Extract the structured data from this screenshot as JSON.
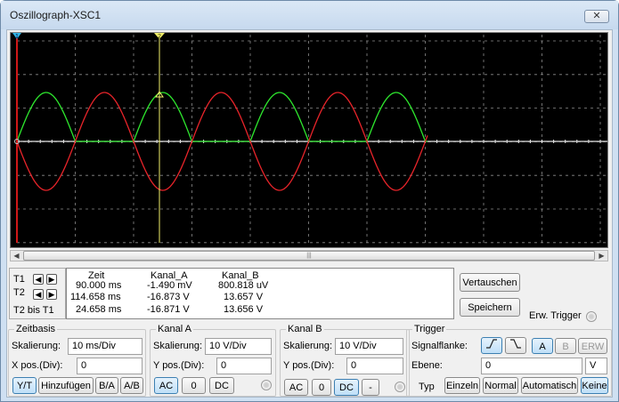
{
  "window": {
    "title": "Oszillograph-XSC1",
    "close_label": "✕"
  },
  "cursors": {
    "t1_label": "T1",
    "t2_label": "T2",
    "diff_label": "T2 bis T1",
    "t1_marker": "1",
    "t2_marker": "2"
  },
  "readout": {
    "headers": [
      "Zeit",
      "Kanal_A",
      "Kanal_B"
    ],
    "rows": [
      [
        "90.000 ms",
        "-1.490 mV",
        "800.818 uV"
      ],
      [
        "114.658 ms",
        "-16.873 V",
        "13.657 V"
      ],
      [
        "24.658 ms",
        "-16.871 V",
        "13.656 V"
      ]
    ]
  },
  "actions": {
    "swap_label": "Vertauschen",
    "save_label": "Speichern",
    "ext_trigger_label": "Erw. Trigger"
  },
  "scrollbar": {
    "left": "◀",
    "right": "▶",
    "grip": "|||"
  },
  "zeitbasis": {
    "title": "Zeitbasis",
    "scale_label": "Skalierung:",
    "scale_value": "10 ms/Div",
    "xpos_label": "X pos.(Div):",
    "xpos_value": "0",
    "buttons": [
      "Y/T",
      "Hinzufügen",
      "B/A",
      "A/B"
    ],
    "active": "Y/T"
  },
  "kanal_a": {
    "title": "Kanal A",
    "scale_label": "Skalierung:",
    "scale_value": "10  V/Div",
    "ypos_label": "Y pos.(Div):",
    "ypos_value": "0",
    "buttons": [
      "AC",
      "0",
      "DC"
    ],
    "active": "AC"
  },
  "kanal_b": {
    "title": "Kanal B",
    "scale_label": "Skalierung:",
    "scale_value": "10  V/Div",
    "ypos_label": "Y pos.(Div):",
    "ypos_value": "0",
    "buttons": [
      "AC",
      "0",
      "DC",
      "-"
    ],
    "active": "DC"
  },
  "trigger": {
    "title": "Trigger",
    "edge_label": "Signalflanke:",
    "level_label": "Ebene:",
    "level_value": "0",
    "level_unit": "V",
    "type_label": "Typ",
    "sources": [
      "A",
      "B",
      "ERW"
    ],
    "active_source": "A",
    "types": [
      "Einzeln",
      "Normal",
      "Automatisch",
      "Keine"
    ],
    "active_type": "Keine"
  },
  "colors": {
    "channel_a": "#e8242a",
    "channel_b": "#2ee82e",
    "grid": "#8c8c8c",
    "cursor1": "#33b6e8",
    "cursor2": "#f2f06a"
  },
  "icons": {
    "edge_rising": "rising-edge-icon",
    "edge_falling": "falling-edge-icon"
  }
}
